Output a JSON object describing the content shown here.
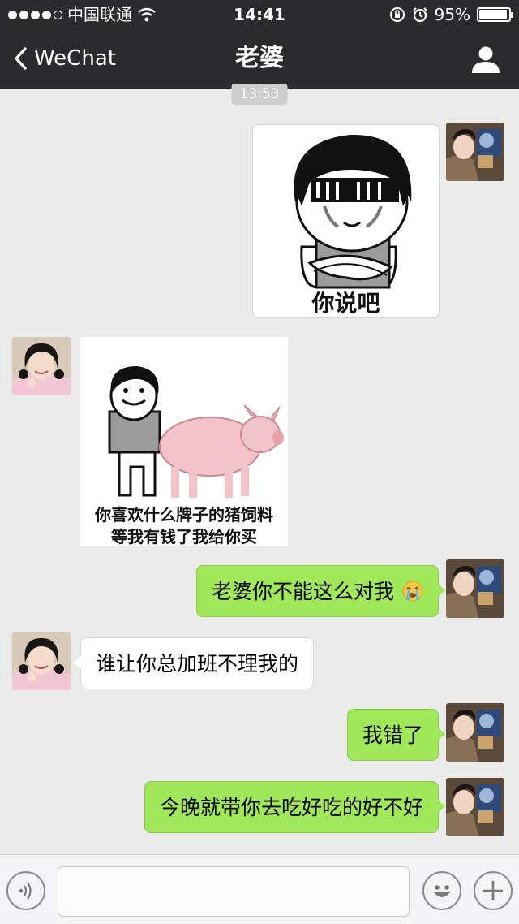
{
  "status_bar": {
    "carrier": "中国联通",
    "time": "14:41",
    "battery_percent": "95%",
    "battery_level": 0.95,
    "icons": [
      "signal-dots-icon",
      "wifi-icon",
      "rotation-lock-icon",
      "alarm-icon",
      "battery-icon"
    ]
  },
  "nav": {
    "back_label": "WeChat",
    "title": "老婆",
    "profile_icon": "person-icon"
  },
  "chat": {
    "timestamp": "13:53",
    "messages": [
      {
        "side": "right",
        "type": "sticker",
        "caption": "你说吧"
      },
      {
        "side": "left",
        "type": "sticker",
        "caption_line1": "你喜欢什么牌子的猪饲料",
        "caption_line2": "等我有钱了我给你买"
      },
      {
        "side": "right",
        "type": "text",
        "text": "老婆你不能这么对我",
        "emoji": "crying-emoji-icon"
      },
      {
        "side": "left",
        "type": "text",
        "text": "谁让你总加班不理我的"
      },
      {
        "side": "right",
        "type": "text",
        "text": "我错了"
      },
      {
        "side": "right",
        "type": "text",
        "text": "今晚就带你去吃好吃的好不好"
      }
    ]
  },
  "input_bar": {
    "voice_icon": "voice-icon",
    "emoji_icon": "emoji-icon",
    "plus_icon": "plus-icon",
    "text_value": ""
  },
  "colors": {
    "top_bar": "#2b2b2e",
    "chat_bg": "#ebebeb",
    "bubble_green": "#a0e75a",
    "bubble_white": "#ffffff"
  }
}
